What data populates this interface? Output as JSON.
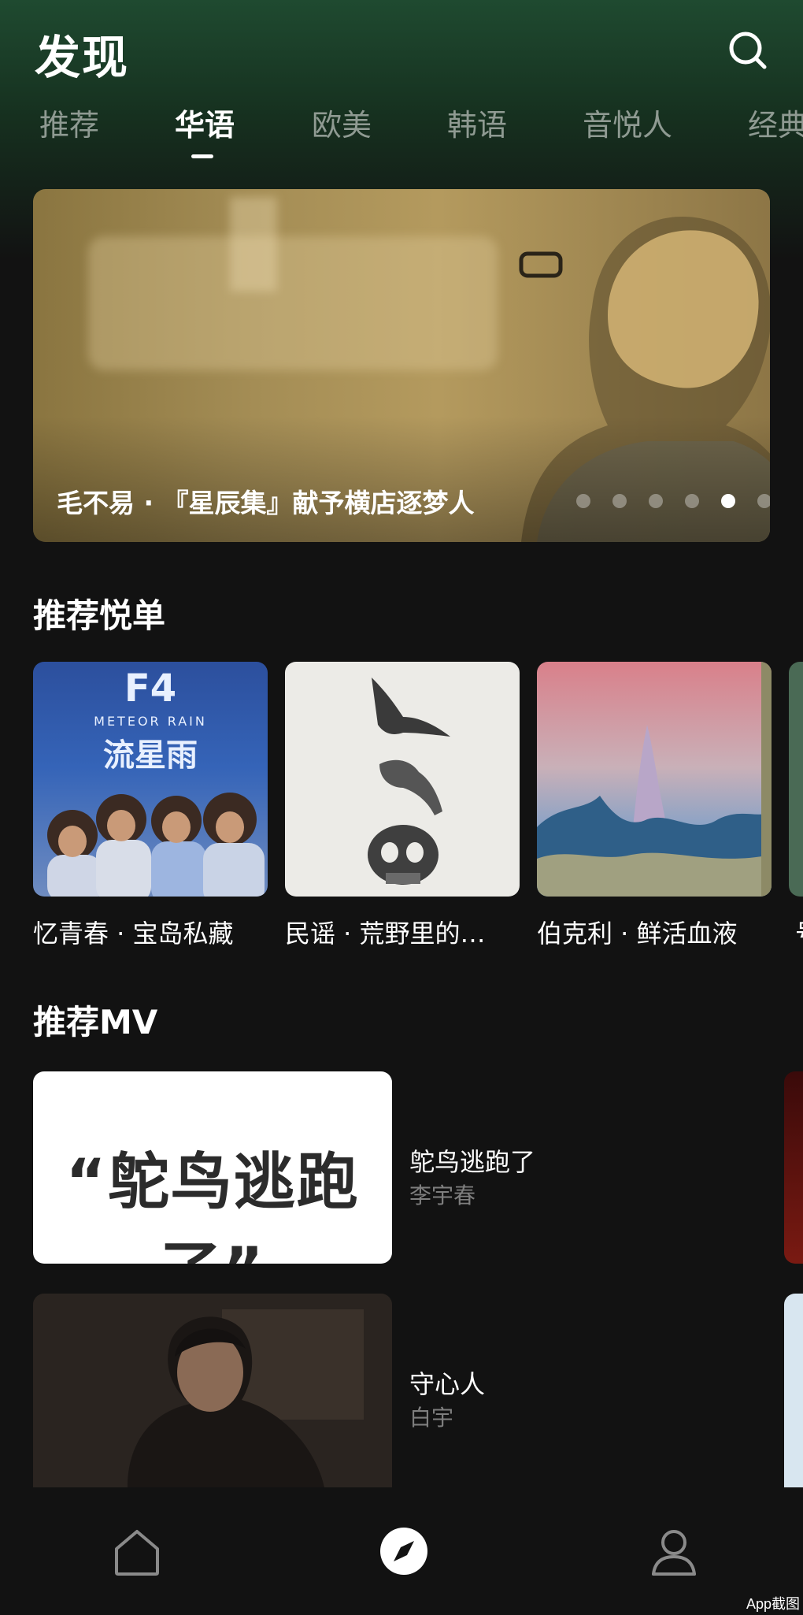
{
  "header": {
    "title": "发现",
    "search_icon": "search-icon"
  },
  "tabs": [
    {
      "label": "推荐",
      "active": false
    },
    {
      "label": "华语",
      "active": true
    },
    {
      "label": "欧美",
      "active": false
    },
    {
      "label": "韩语",
      "active": false
    },
    {
      "label": "音悦人",
      "active": false
    },
    {
      "label": "经典",
      "active": false
    }
  ],
  "banner": {
    "caption": "毛不易 · 『星辰集』献予横店逐梦人",
    "slide_count": 6,
    "active_slide": 5
  },
  "playlists": {
    "title": "推荐悦单",
    "items": [
      {
        "name": "忆青春 · 宝岛私藏",
        "cover_text": "F4",
        "cover_sub": "METEOR RAIN",
        "cover_cn": "流星雨"
      },
      {
        "name": "民谣 · 荒野里的…"
      },
      {
        "name": "伯克利 · 鲜活血液"
      }
    ]
  },
  "mv": {
    "title": "推荐MV",
    "items": [
      {
        "title": "鸵鸟逃跑了",
        "artist": "李宇春",
        "thumb_text": "“鸵鸟逃跑了”"
      },
      {
        "title": "守心人",
        "artist": "白宇"
      }
    ]
  },
  "nav": {
    "items": [
      {
        "icon": "home-icon",
        "active": false
      },
      {
        "icon": "compass-icon",
        "active": true
      },
      {
        "icon": "profile-icon",
        "active": false
      }
    ]
  },
  "watermark": "App截图",
  "colors": {
    "background": "#121212",
    "header_gradient": "#1f4a30",
    "inactive_tab": "#8f9a92",
    "secondary_text": "#7e7e7e"
  }
}
